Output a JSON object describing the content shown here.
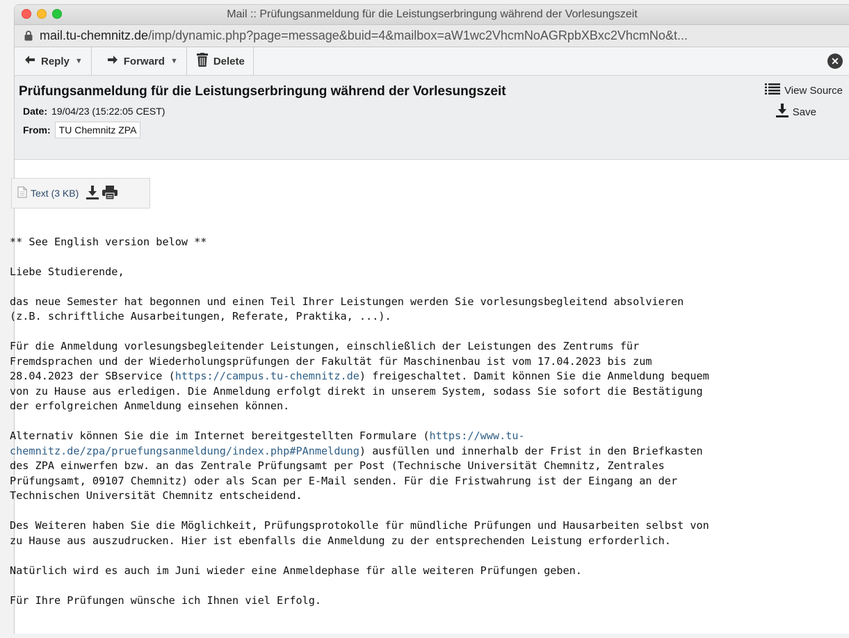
{
  "window": {
    "title": "Mail :: Prüfungsanmeldung für die Leistungserbringung während der Vorlesungszeit"
  },
  "urlbar": {
    "domain": "mail.tu-chemnitz.de",
    "path": "/imp/dynamic.php?page=message&buid=4&mailbox=aW1wc2VhcmNoAGRpbXBxc2VhcmNo&t..."
  },
  "toolbar": {
    "reply_label": "Reply",
    "forward_label": "Forward",
    "delete_label": "Delete"
  },
  "message": {
    "subject": "Prüfungsanmeldung für die Leistungserbringung während der Vorlesungszeit",
    "date_label": "Date:",
    "date_value": "19/04/23 (15:22:05 CEST)",
    "from_label": "From:",
    "from_value": "TU Chemnitz ZPA",
    "view_source_label": "View Source",
    "save_label": "Save"
  },
  "attachment": {
    "label": "Text (3 KB)"
  },
  "body": {
    "p1": "** See English version below **",
    "p2": "Liebe Studierende,",
    "p3": "das neue Semester hat begonnen und einen Teil Ihrer Leistungen werden Sie vorlesungsbegleitend absolvieren\n(z.B. schriftliche Ausarbeitungen, Referate, Praktika, ...).",
    "p4_a": "Für die Anmeldung vorlesungsbegleitender Leistungen, einschließlich der Leistungen des Zentrums für\nFremdsprachen und der Wiederholungsprüfungen der Fakultät für Maschinenbau ist vom 17.04.2023 bis zum\n28.04.2023 der SBservice (",
    "p4_link": "https://campus.tu-chemnitz.de",
    "p4_b": ") freigeschaltet. Damit können Sie die Anmeldung bequem\nvon zu Hause aus erledigen. Die Anmeldung erfolgt direkt in unserem System, sodass Sie sofort die Bestätigung\nder erfolgreichen Anmeldung einsehen können.",
    "p5_a": "Alternativ können Sie die im Internet bereitgestellten Formulare (",
    "p5_link": "https://www.tu-\nchemnitz.de/zpa/pruefungsanmeldung/index.php#PAnmeldung",
    "p5_b": ") ausfüllen und innerhalb der Frist in den Briefkasten\ndes ZPA einwerfen bzw. an das Zentrale Prüfungsamt per Post (Technische Universität Chemnitz, Zentrales\nPrüfungsamt, 09107 Chemnitz) oder als Scan per E-Mail senden. Für die Fristwahrung ist der Eingang an der\nTechnischen Universität Chemnitz entscheidend.",
    "p6": "Des Weiteren haben Sie die Möglichkeit, Prüfungsprotokolle für mündliche Prüfungen und Hausarbeiten selbst von\nzu Hause aus auszudrucken. Hier ist ebenfalls die Anmeldung zu der entsprechenden Leistung erforderlich.",
    "p7": "Natürlich wird es auch im Juni wieder eine Anmeldephase für alle weiteren Prüfungen geben.",
    "p8": "Für Ihre Prüfungen wünsche ich Ihnen viel Erfolg."
  },
  "icons": {
    "lock": "lock-icon",
    "reply": "arrow-left-icon",
    "forward": "arrow-right-icon",
    "delete": "trash-icon",
    "close": "close-icon",
    "view_source": "list-icon",
    "save": "download-icon",
    "attachment": "file-icon",
    "download": "download-icon",
    "print": "printer-icon"
  }
}
